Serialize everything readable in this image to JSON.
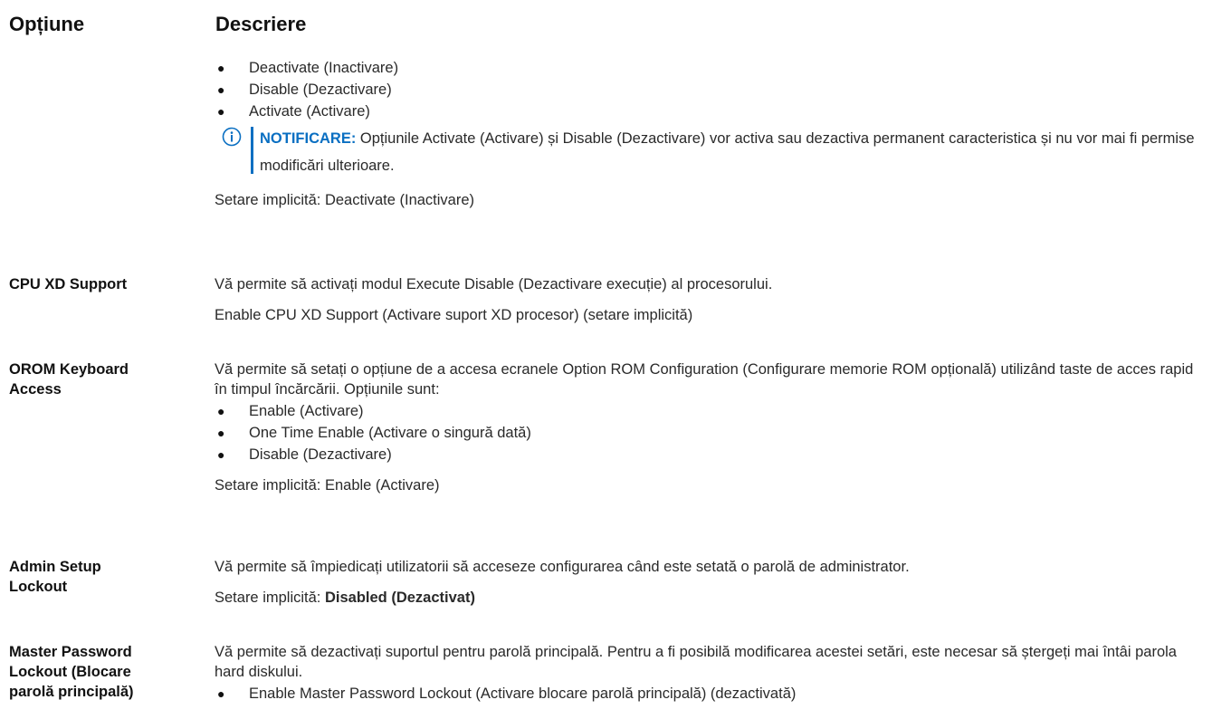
{
  "header": {
    "option": "Opțiune",
    "description": "Descriere"
  },
  "section0": {
    "bullets": [
      "Deactivate (Inactivare)",
      "Disable (Dezactivare)",
      "Activate (Activare)"
    ],
    "note_label": "NOTIFICARE:",
    "note_text": " Opțiunile Activate (Activare) și Disable (Dezactivare) vor activa sau dezactiva permanent caracteristica și nu vor mai fi permise modificări ulterioare.",
    "default": "Setare implicită: Deactivate (Inactivare)"
  },
  "cpu_xd": {
    "label": "CPU XD Support",
    "desc": "Vă permite să activați modul Execute Disable (Dezactivare execuție) al procesorului.",
    "default": "Enable CPU XD Support (Activare suport XD procesor) (setare implicită)"
  },
  "orom": {
    "label_line1": "OROM Keyboard",
    "label_line2": "Access",
    "desc": "Vă permite să setați o opțiune de a accesa ecranele Option ROM Configuration (Configurare memorie ROM opțională) utilizând taste de acces rapid în timpul încărcării. Opțiunile sunt:",
    "bullets": [
      "Enable (Activare)",
      "One Time Enable (Activare o singură dată)",
      "Disable (Dezactivare)"
    ],
    "default": "Setare implicită: Enable (Activare)"
  },
  "admin": {
    "label_line1": "Admin Setup",
    "label_line2": "Lockout",
    "desc": "Vă permite să împiedicați utilizatorii să acceseze configurarea când este setată o parolă de administrator.",
    "default_prefix": "Setare implicită: ",
    "default_value": "Disabled (Dezactivat)"
  },
  "master": {
    "label_line1": "Master Password",
    "label_line2": "Lockout (Blocare",
    "label_line3": "parolă principală)",
    "desc": "Vă permite să dezactivați suportul pentru parolă principală. Pentru a fi posibilă modificarea acestei setări, este necesar să ștergeți mai întâi parola hard diskului.",
    "bullets": [
      "Enable Master Password Lockout (Activare blocare parolă principală) (dezactivată)"
    ]
  }
}
